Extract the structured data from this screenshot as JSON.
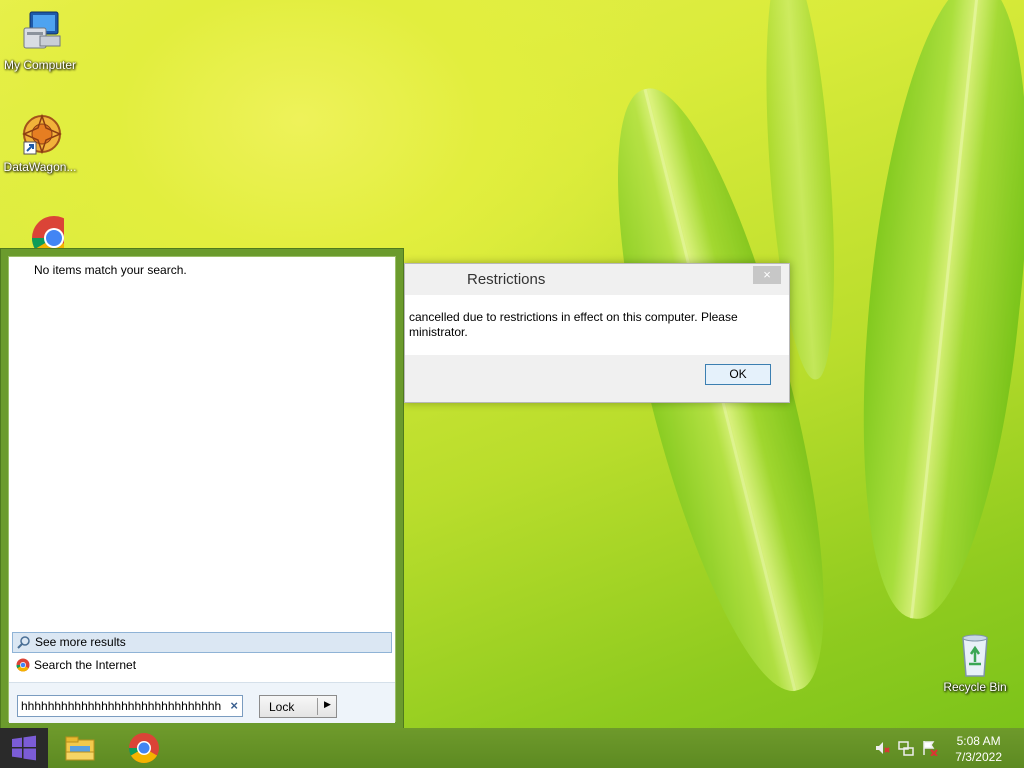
{
  "desktop": {
    "icons": [
      {
        "label": "My Computer"
      },
      {
        "label": "DataWagon..."
      },
      {
        "label": "Google Chrome"
      },
      {
        "label": "Recycle Bin"
      }
    ]
  },
  "start_panel": {
    "no_items_text": "No items match your search.",
    "see_more_label": "See more results",
    "search_internet_label": "Search the Internet",
    "search_value": "hhhhhhhhhhhhhhhhhhhhhhhhhhhhhh",
    "clear_symbol": "×",
    "lock_label": "Lock",
    "lock_arrow": "▶"
  },
  "dialog": {
    "title": "Restrictions",
    "close_symbol": "×",
    "message_line1": "cancelled due to restrictions in effect on this computer. Please",
    "message_line2": "ministrator.",
    "ok_label": "OK"
  },
  "taskbar": {
    "time": "5:08 AM",
    "date": "7/3/2022",
    "pinned": [
      "file-explorer-icon",
      "chrome-icon"
    ],
    "tray_icons": [
      "volume-muted-icon",
      "network-icon",
      "action-center-icon"
    ]
  },
  "colors": {
    "taskbar": "#5d8a22",
    "start_panel_border": "#6b9b2d",
    "accent_blue": "#3c7fb1"
  }
}
